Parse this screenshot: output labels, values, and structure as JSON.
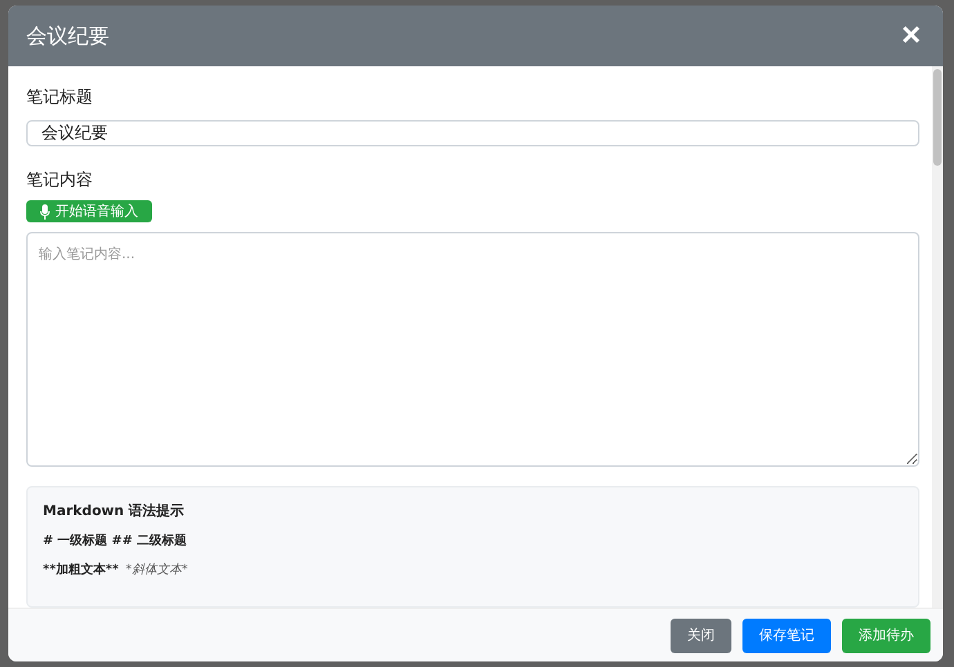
{
  "dialog": {
    "title": "会议纪要",
    "close_icon": "×"
  },
  "title_field": {
    "label": "笔记标题",
    "value": "会议纪要"
  },
  "content_field": {
    "label": "笔记内容",
    "voice_button": "开始语音输入",
    "placeholder": "输入笔记内容..."
  },
  "markdown_tips": {
    "heading": "Markdown 语法提示",
    "lines": [
      [
        "# 一级标题 ## 二级标题"
      ],
      [
        "**加粗文本**",
        "*斜体文本*"
      ]
    ]
  },
  "buttons": [
    {
      "label": "关闭",
      "kind": "secondary"
    },
    {
      "label": "保存笔记",
      "kind": "primary"
    },
    {
      "label": "添加待办",
      "kind": "success"
    }
  ]
}
